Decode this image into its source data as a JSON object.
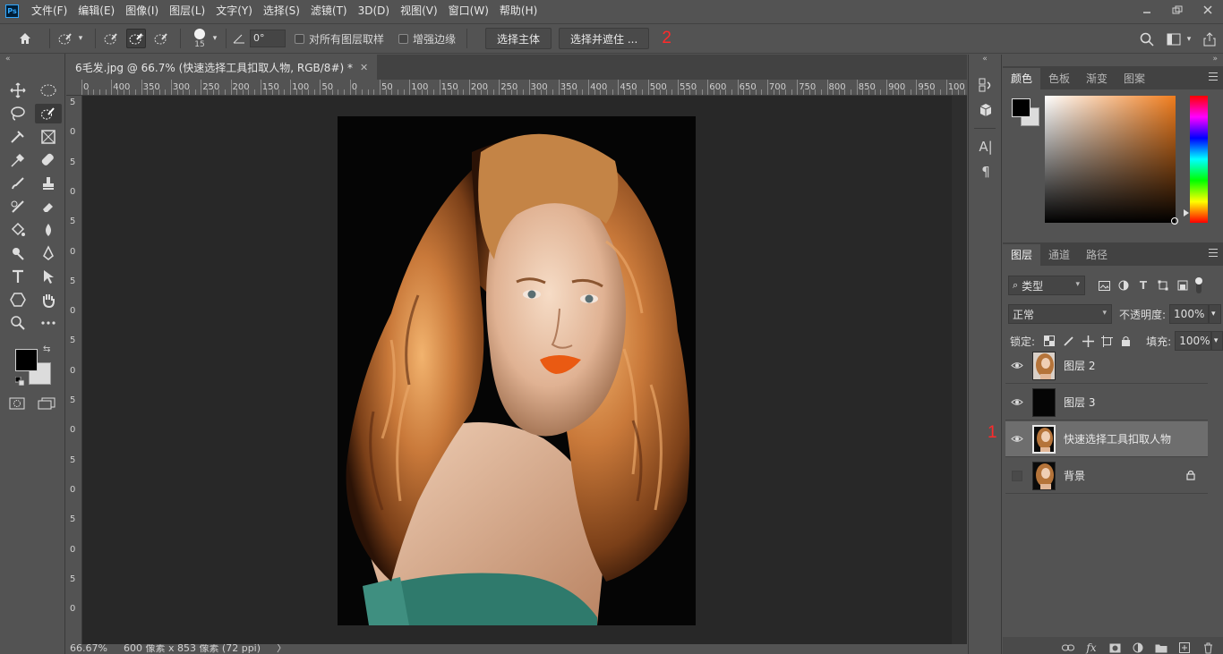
{
  "app": {
    "logo": "Ps"
  },
  "menu": [
    "文件(F)",
    "编辑(E)",
    "图像(I)",
    "图层(L)",
    "文字(Y)",
    "选择(S)",
    "滤镜(T)",
    "3D(D)",
    "视图(V)",
    "窗口(W)",
    "帮助(H)"
  ],
  "window_controls": [
    "minimize-icon",
    "restore-icon",
    "close-icon"
  ],
  "options": {
    "brush_size": "15",
    "angle_value": "0°",
    "sample_all_layers_label": "对所有图层取样",
    "sample_all_layers_checked": false,
    "enhance_edge_label": "增强边缘",
    "enhance_edge_checked": false,
    "select_subject_label": "选择主体",
    "select_mask_label": "选择并遮住 ...",
    "annotation_2": "2"
  },
  "document": {
    "tab_title": "6毛发.jpg @ 66.7% (快速选择工具扣取人物, RGB/8#) *",
    "ruler_labels": [
      "0",
      "400",
      "350",
      "300",
      "250",
      "200",
      "150",
      "100",
      "50",
      "0",
      "50",
      "100",
      "150",
      "200",
      "250",
      "300",
      "350",
      "400",
      "450",
      "500",
      "550",
      "600",
      "650",
      "700",
      "750",
      "800",
      "850",
      "900",
      "950",
      "100"
    ],
    "ruler_left_labels": [
      "5",
      "0",
      "5",
      "0",
      "5",
      "0",
      "5",
      "0",
      "5",
      "0",
      "5",
      "0",
      "5",
      "0",
      "5",
      "0",
      "5",
      "0"
    ]
  },
  "status": {
    "zoom": "66.67%",
    "doc_info": "600 像素 x 853 像素 (72 ppi)",
    "arrow": "〉"
  },
  "color_panel": {
    "tabs": [
      "颜色",
      "色板",
      "渐变",
      "图案"
    ],
    "active_tab": "颜色",
    "foreground": "#000000",
    "background": "#dcdcdc",
    "hue_color": "#f07d1e"
  },
  "layers_panel": {
    "tabs": [
      "图层",
      "通道",
      "路径"
    ],
    "active_tab": "图层",
    "filter_label": "类型",
    "blend_mode": "正常",
    "opacity_label": "不透明度:",
    "opacity_value": "100%",
    "lock_label": "锁定:",
    "fill_label": "填充:",
    "fill_value": "100%",
    "layers": [
      {
        "name": "图层 2",
        "visible": true,
        "selected": false,
        "locked": false,
        "thumb": "portrait"
      },
      {
        "name": "图层 3",
        "visible": true,
        "selected": false,
        "locked": false,
        "thumb": "black"
      },
      {
        "name": "快速选择工具扣取人物",
        "visible": true,
        "selected": true,
        "locked": false,
        "thumb": "portrait"
      },
      {
        "name": "背景",
        "visible": false,
        "selected": false,
        "locked": true,
        "thumb": "portrait"
      }
    ],
    "annotation_1": "1",
    "footer_icons": [
      "link-icon",
      "fx-icon",
      "mask-icon",
      "adjustment-icon",
      "folder-icon",
      "new-layer-icon",
      "trash-icon"
    ],
    "footer_fx": "fx"
  },
  "dock": {
    "icons": [
      "history-icon",
      "3d-icon",
      "character-icon",
      "paragraph-icon"
    ],
    "character_glyph": "A|",
    "paragraph_glyph": "¶"
  }
}
